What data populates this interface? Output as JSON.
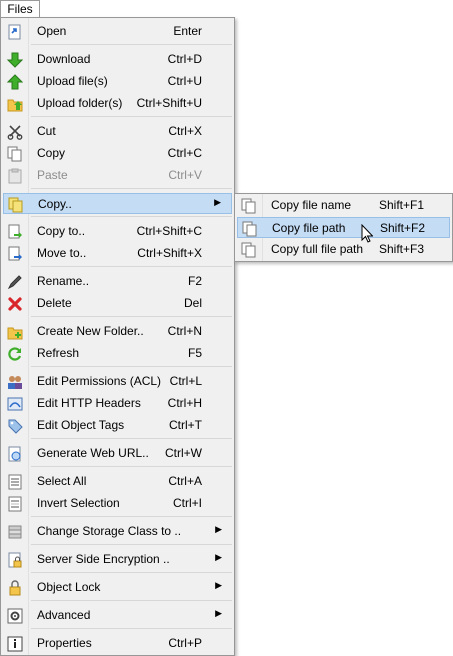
{
  "menubar": {
    "files_label": "Files"
  },
  "main_menu": {
    "items": [
      {
        "label": "Open",
        "shortcut": "Enter",
        "icon": "open-icon"
      },
      {
        "label": "Download",
        "shortcut": "Ctrl+D",
        "icon": "download-icon"
      },
      {
        "label": "Upload file(s)",
        "shortcut": "Ctrl+U",
        "icon": "upload-icon"
      },
      {
        "label": "Upload folder(s)",
        "shortcut": "Ctrl+Shift+U",
        "icon": "upload-folder-icon"
      },
      {
        "label": "Cut",
        "shortcut": "Ctrl+X",
        "icon": "cut-icon"
      },
      {
        "label": "Copy",
        "shortcut": "Ctrl+C",
        "icon": "copy-icon"
      },
      {
        "label": "Paste",
        "shortcut": "Ctrl+V",
        "icon": "paste-icon",
        "disabled": true
      },
      {
        "label": "Copy..",
        "shortcut": "",
        "icon": "copy-submenu-icon",
        "submenu": true
      },
      {
        "label": "Copy to..",
        "shortcut": "Ctrl+Shift+C",
        "icon": "copy-to-icon"
      },
      {
        "label": "Move to..",
        "shortcut": "Ctrl+Shift+X",
        "icon": "move-to-icon"
      },
      {
        "label": "Rename..",
        "shortcut": "F2",
        "icon": "rename-icon"
      },
      {
        "label": "Delete",
        "shortcut": "Del",
        "icon": "delete-icon"
      },
      {
        "label": "Create New Folder..",
        "shortcut": "Ctrl+N",
        "icon": "new-folder-icon"
      },
      {
        "label": "Refresh",
        "shortcut": "F5",
        "icon": "refresh-icon"
      },
      {
        "label": "Edit Permissions (ACL)",
        "shortcut": "Ctrl+L",
        "icon": "permissions-icon"
      },
      {
        "label": "Edit HTTP Headers",
        "shortcut": "Ctrl+H",
        "icon": "http-headers-icon"
      },
      {
        "label": "Edit Object Tags",
        "shortcut": "Ctrl+T",
        "icon": "tags-icon"
      },
      {
        "label": "Generate Web URL..",
        "shortcut": "Ctrl+W",
        "icon": "web-url-icon"
      },
      {
        "label": "Select All",
        "shortcut": "Ctrl+A",
        "icon": "select-all-icon"
      },
      {
        "label": "Invert Selection",
        "shortcut": "Ctrl+I",
        "icon": "invert-selection-icon"
      },
      {
        "label": "Change Storage Class to ..",
        "shortcut": "",
        "icon": "storage-class-icon",
        "submenu": true
      },
      {
        "label": "Server Side Encryption ..",
        "shortcut": "",
        "icon": "encryption-icon",
        "submenu": true
      },
      {
        "label": "Object Lock",
        "shortcut": "",
        "icon": "lock-icon",
        "submenu": true
      },
      {
        "label": "Advanced",
        "shortcut": "",
        "icon": "advanced-icon",
        "submenu": true
      },
      {
        "label": "Properties",
        "shortcut": "Ctrl+P",
        "icon": "properties-icon"
      }
    ]
  },
  "copy_submenu": {
    "items": [
      {
        "label": "Copy file name",
        "shortcut": "Shift+F1",
        "icon": "copy-icon"
      },
      {
        "label": "Copy file path",
        "shortcut": "Shift+F2",
        "icon": "copy-icon",
        "highlighted": true
      },
      {
        "label": "Copy full file path",
        "shortcut": "Shift+F3",
        "icon": "copy-icon"
      }
    ]
  },
  "colors": {
    "highlight": "#c4dcf4",
    "highlight_border": "#98c0e6",
    "menu_bg": "#f0f0f0"
  }
}
